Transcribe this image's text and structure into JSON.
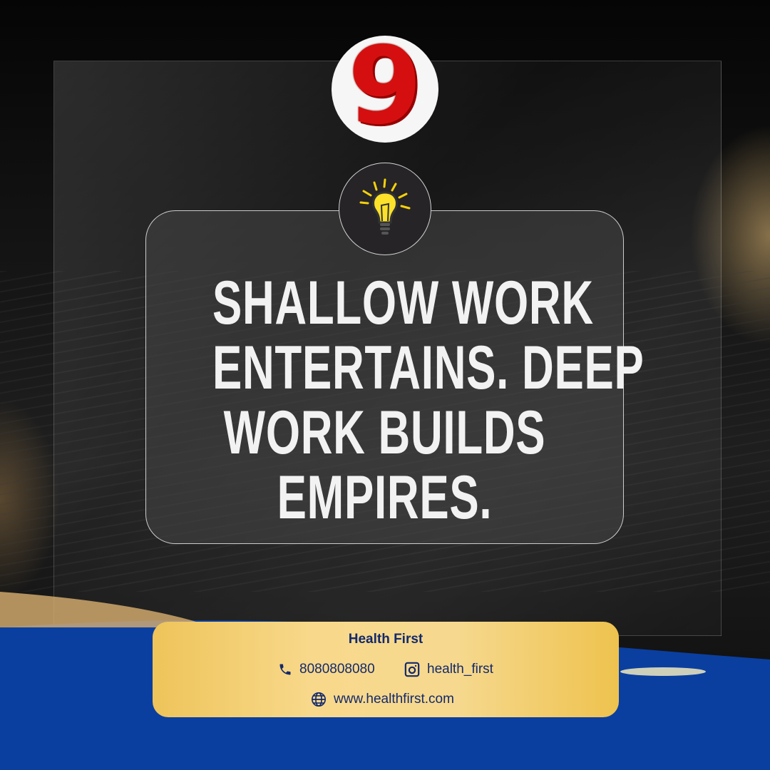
{
  "badge": {
    "number": "9",
    "icon": "lightbulb-icon"
  },
  "quote": {
    "lines": [
      "SHALLOW WORK",
      "ENTERTAINS. DEEP",
      "WORK BUILDS",
      "EMPIRES."
    ]
  },
  "footer": {
    "brand": "Health First",
    "phone": "8080808080",
    "instagram": "health_first",
    "website": "www.healthfirst.com"
  },
  "colors": {
    "number": "#d50f0f",
    "footer_bg": "#f6d98f",
    "footer_text": "#14296b",
    "swoosh": "#0a3fa0"
  }
}
